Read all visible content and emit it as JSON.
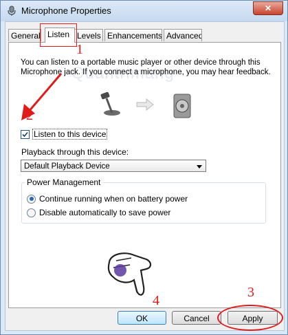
{
  "window": {
    "title": "Microphone Properties",
    "close_glyph": "✕"
  },
  "tabs": [
    {
      "label": "General",
      "active": false
    },
    {
      "label": "Listen",
      "active": true
    },
    {
      "label": "Levels",
      "active": false
    },
    {
      "label": "Enhancements",
      "active": false
    },
    {
      "label": "Advanced",
      "active": false
    }
  ],
  "listen": {
    "description": "You can listen to a portable music player or other device through this Microphone jack.  If you connect a microphone, you may hear feedback.",
    "checkbox_label": "Listen to this device",
    "checkbox_checked": true,
    "playback_label": "Playback through this device:",
    "playback_value": "Default Playback Device",
    "power_group_title": "Power Management",
    "radio_continue": "Continue running when on battery power",
    "radio_disable": "Disable automatically to save power",
    "radio_selected": "continue"
  },
  "buttons": {
    "ok": "OK",
    "cancel": "Cancel",
    "apply": "Apply"
  },
  "annotations": {
    "num1": "1",
    "num2": "2",
    "num3": "3",
    "num4": "4",
    "watermark": "Quantrimang",
    "color": "#e01b1b"
  }
}
